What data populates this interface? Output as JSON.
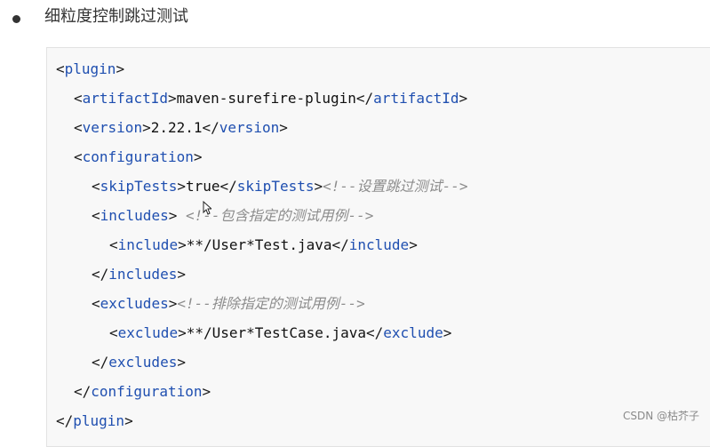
{
  "heading": {
    "text": "细粒度控制跳过测试"
  },
  "code": {
    "lines": [
      {
        "open": "<",
        "name": "plugin",
        "close": ">",
        "text": "",
        "end_open": "",
        "end_name": "",
        "end_close": "",
        "comment": ""
      },
      {
        "open": "<",
        "name": "artifactId",
        "close": ">",
        "text": "maven-surefire-plugin",
        "end_open": "</",
        "end_name": "artifactId",
        "end_close": ">",
        "comment": ""
      },
      {
        "open": "<",
        "name": "version",
        "close": ">",
        "text": "2.22.1",
        "end_open": "</",
        "end_name": "version",
        "end_close": ">",
        "comment": ""
      },
      {
        "open": "<",
        "name": "configuration",
        "close": ">",
        "text": "",
        "end_open": "",
        "end_name": "",
        "end_close": "",
        "comment": ""
      },
      {
        "open": "<",
        "name": "skipTests",
        "close": ">",
        "text": "true",
        "end_open": "</",
        "end_name": "skipTests",
        "end_close": ">",
        "comment": "<!--设置跳过测试-->"
      },
      {
        "open": "<",
        "name": "includes",
        "close": ">",
        "text": " ",
        "end_open": "",
        "end_name": "",
        "end_close": "",
        "comment": "<!--包含指定的测试用例-->"
      },
      {
        "open": "<",
        "name": "include",
        "close": ">",
        "text": "**/User*Test.java",
        "end_open": "</",
        "end_name": "include",
        "end_close": ">",
        "comment": ""
      },
      {
        "open": "</",
        "name": "includes",
        "close": ">",
        "text": "",
        "end_open": "",
        "end_name": "",
        "end_close": "",
        "comment": ""
      },
      {
        "open": "<",
        "name": "excludes",
        "close": ">",
        "text": "",
        "end_open": "",
        "end_name": "",
        "end_close": "",
        "comment": "<!--排除指定的测试用例-->"
      },
      {
        "open": "<",
        "name": "exclude",
        "close": ">",
        "text": "**/User*TestCase.java",
        "end_open": "</",
        "end_name": "exclude",
        "end_close": ">",
        "comment": ""
      },
      {
        "open": "</",
        "name": "excludes",
        "close": ">",
        "text": "",
        "end_open": "",
        "end_name": "",
        "end_close": "",
        "comment": ""
      },
      {
        "open": "</",
        "name": "configuration",
        "close": ">",
        "text": "",
        "end_open": "",
        "end_name": "",
        "end_close": "",
        "comment": ""
      },
      {
        "open": "</",
        "name": "plugin",
        "close": ">",
        "text": "",
        "end_open": "",
        "end_name": "",
        "end_close": "",
        "comment": ""
      }
    ]
  },
  "watermark": {
    "text": "CSDN @枯芥子"
  },
  "icons": {
    "cursor": "mouse-pointer-icon"
  }
}
